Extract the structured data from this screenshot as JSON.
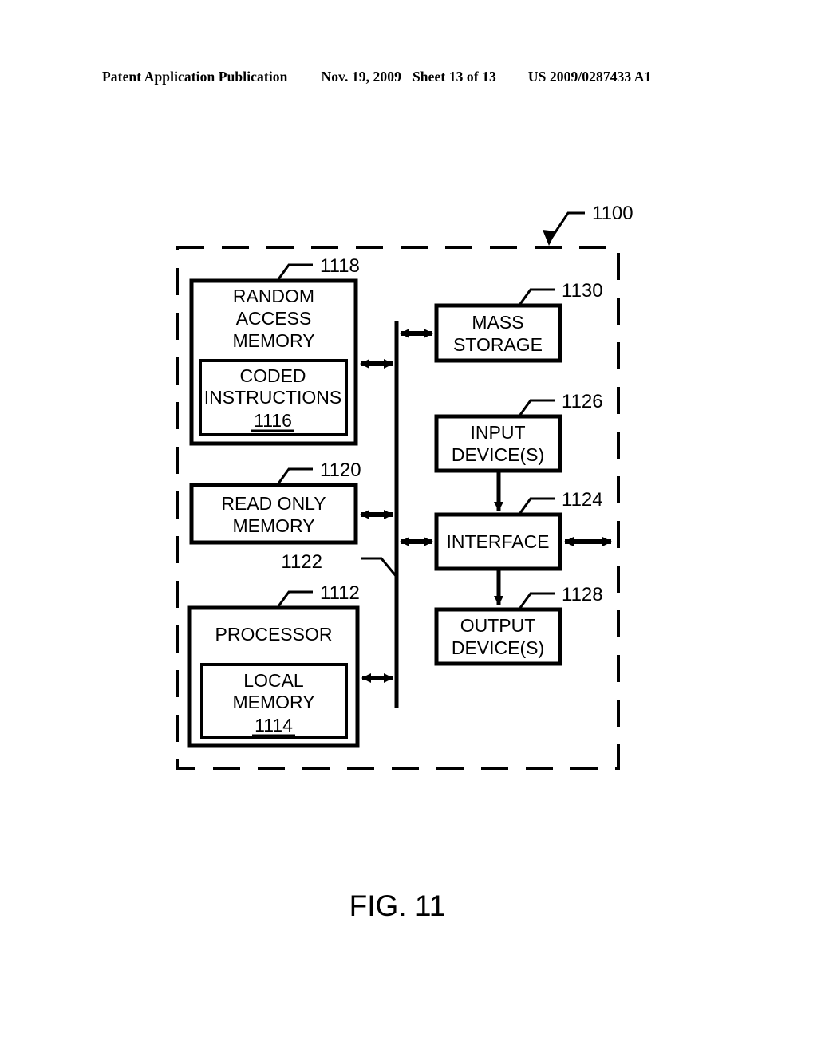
{
  "header": {
    "publication": "Patent Application Publication",
    "date": "Nov. 19, 2009",
    "sheet": "Sheet 13 of 13",
    "patent_number": "US 2009/0287433 A1"
  },
  "figure": {
    "caption": "FIG. 11",
    "system_ref": "1100",
    "bus_ref": "1122",
    "colors": {
      "ink": "#000000",
      "paper": "#ffffff"
    },
    "blocks": [
      {
        "id": "random-access-memory",
        "label_lines": [
          "RANDOM",
          "ACCESS",
          "MEMORY"
        ],
        "ref": "1118",
        "nested": {
          "id": "coded-instructions",
          "label_lines": [
            "CODED",
            "INSTRUCTIONS"
          ],
          "ref": "1116"
        }
      },
      {
        "id": "read-only-memory",
        "label_lines": [
          "READ ONLY",
          "MEMORY"
        ],
        "ref": "1120"
      },
      {
        "id": "processor",
        "label_lines": [
          "PROCESSOR"
        ],
        "ref": "1112",
        "nested": {
          "id": "local-memory",
          "label_lines": [
            "LOCAL",
            "MEMORY"
          ],
          "ref": "1114"
        }
      },
      {
        "id": "mass-storage",
        "label_lines": [
          "MASS",
          "STORAGE"
        ],
        "ref": "1130"
      },
      {
        "id": "input-devices",
        "label_lines": [
          "INPUT",
          "DEVICE(S)"
        ],
        "ref": "1126"
      },
      {
        "id": "interface",
        "label_lines": [
          "INTERFACE"
        ],
        "ref": "1124"
      },
      {
        "id": "output-devices",
        "label_lines": [
          "OUTPUT",
          "DEVICE(S)"
        ],
        "ref": "1128"
      }
    ],
    "text": {
      "ram_l1": "RANDOM",
      "ram_l2": "ACCESS",
      "ram_l3": "MEMORY",
      "ram_ref": "1118",
      "coded_l1": "CODED",
      "coded_l2": "INSTRUCTIONS",
      "coded_ref": "1116",
      "rom_l1": "READ ONLY",
      "rom_l2": "MEMORY",
      "rom_ref": "1120",
      "proc_l1": "PROCESSOR",
      "proc_ref": "1112",
      "local_l1": "LOCAL",
      "local_l2": "MEMORY",
      "local_ref": "1114",
      "mass_l1": "MASS",
      "mass_l2": "STORAGE",
      "mass_ref": "1130",
      "input_l1": "INPUT",
      "input_l2": "DEVICE(S)",
      "input_ref": "1126",
      "iface_l1": "INTERFACE",
      "iface_ref": "1124",
      "output_l1": "OUTPUT",
      "output_l2": "DEVICE(S)",
      "output_ref": "1128",
      "bus_ref": "1122",
      "system_ref": "1100",
      "caption": "FIG. 11"
    }
  }
}
